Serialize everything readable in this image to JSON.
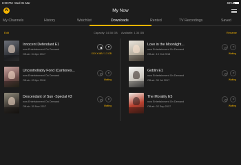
{
  "statusbar": {
    "time": "6:30 PM",
    "date": "Wed 31 Mar",
    "battery": "69%"
  },
  "header": {
    "title": "My Now"
  },
  "tabs": [
    {
      "label": "My Channels"
    },
    {
      "label": "History"
    },
    {
      "label": "Watchlist"
    },
    {
      "label": "Downloads"
    },
    {
      "label": "Rented"
    },
    {
      "label": "TV Recordings"
    },
    {
      "label": "Saved"
    }
  ],
  "active_tab": "Downloads",
  "subbar": {
    "edit": "Edit",
    "capacity": "Capacity: 14.58 GB",
    "available": "Available: 1.34 GB",
    "rename": "Rename"
  },
  "colors": {
    "accent": "#f5b400",
    "background": "#1c1c1c"
  },
  "left_items": [
    {
      "title": "Innocent Defendant E1",
      "sub": "now Entertainment On Demand",
      "date": "Off-air: 04 Apr 2017",
      "status": "XXX.X MB / 1.3 GB",
      "state": "downloading"
    },
    {
      "title": "Uncontrollably Fond (Cantones...",
      "sub": "now Entertainment On Demand",
      "date": "Off-air: 03 Apr 2018",
      "status": "Waiting",
      "state": "waiting"
    },
    {
      "title": "Descendant of Sun -Special #3",
      "sub": "now Entertainment On Demand",
      "date": "Off-air: 30 Nov 2017",
      "status": "Waiting",
      "state": "waiting"
    }
  ],
  "right_items": [
    {
      "title": "Love in the Moonlight...",
      "sub": "now Entertainment On Demand",
      "date": "Off-air: 19 Oct 2018",
      "status": "Waiting",
      "state": "waiting"
    },
    {
      "title": "Goblin E1",
      "sub": "now Entertainment On Demand",
      "date": "Off-air: 30 Jul 2017",
      "status": "Waiting",
      "state": "waiting"
    },
    {
      "title": "The Morality E5",
      "sub": "now Entertainment On Demand",
      "date": "Off-air: 02 Sep 2017",
      "status": "Waiting",
      "state": "waiting"
    }
  ]
}
